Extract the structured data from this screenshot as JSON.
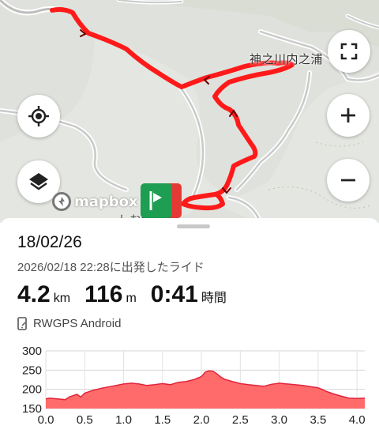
{
  "map": {
    "place_label": "神之川内之浦",
    "bottom_label": "しお台口前",
    "attribution": "mapbox",
    "route_color": "#ff1a1a",
    "buttons": {
      "fullscreen": "fullscreen-icon",
      "locate": "my-location-icon",
      "zoom_in": "plus-icon",
      "zoom_out": "minus-icon",
      "layers": "layers-icon"
    },
    "start_marker_colors": [
      "#1e9e52",
      "#e53935"
    ]
  },
  "activity": {
    "date": "18/02/26",
    "subtitle": "2026/02/18 22:28に出発したライド",
    "stats": {
      "distance_value": "4.2",
      "distance_unit": "km",
      "elevation_value": "116",
      "elevation_unit": "m",
      "duration_value": "0:41",
      "duration_unit": "時間"
    },
    "device": "RWGPS Android",
    "device_icon": "phone-icon"
  },
  "chart_data": {
    "type": "area",
    "title": "",
    "xlabel": "",
    "ylabel": "",
    "xlim": [
      0,
      4.1
    ],
    "ylim": [
      150,
      300
    ],
    "x_ticks": [
      "0.0",
      "0.5",
      "1.0",
      "1.5",
      "2.0",
      "2.5",
      "3.0",
      "3.5",
      "4.0"
    ],
    "y_ticks": [
      "300",
      "250",
      "200",
      "150"
    ],
    "grid": true,
    "fill_color": "#ff6b6b",
    "line_color": "#e0243a",
    "x": [
      0.0,
      0.05,
      0.15,
      0.25,
      0.3,
      0.4,
      0.45,
      0.5,
      0.6,
      0.7,
      0.8,
      0.9,
      1.0,
      1.1,
      1.2,
      1.3,
      1.4,
      1.5,
      1.6,
      1.7,
      1.8,
      1.9,
      2.0,
      2.05,
      2.1,
      2.15,
      2.2,
      2.25,
      2.3,
      2.4,
      2.5,
      2.6,
      2.7,
      2.8,
      2.9,
      3.0,
      3.1,
      3.2,
      3.3,
      3.4,
      3.5,
      3.55,
      3.6,
      3.7,
      3.8,
      3.9,
      4.0,
      4.1
    ],
    "y": [
      175,
      177,
      175,
      173,
      180,
      187,
      180,
      190,
      197,
      202,
      206,
      210,
      214,
      216,
      214,
      210,
      212,
      215,
      212,
      218,
      220,
      225,
      233,
      245,
      248,
      247,
      240,
      232,
      226,
      220,
      215,
      212,
      210,
      208,
      213,
      216,
      214,
      212,
      210,
      207,
      204,
      200,
      195,
      188,
      182,
      177,
      176,
      177
    ]
  }
}
